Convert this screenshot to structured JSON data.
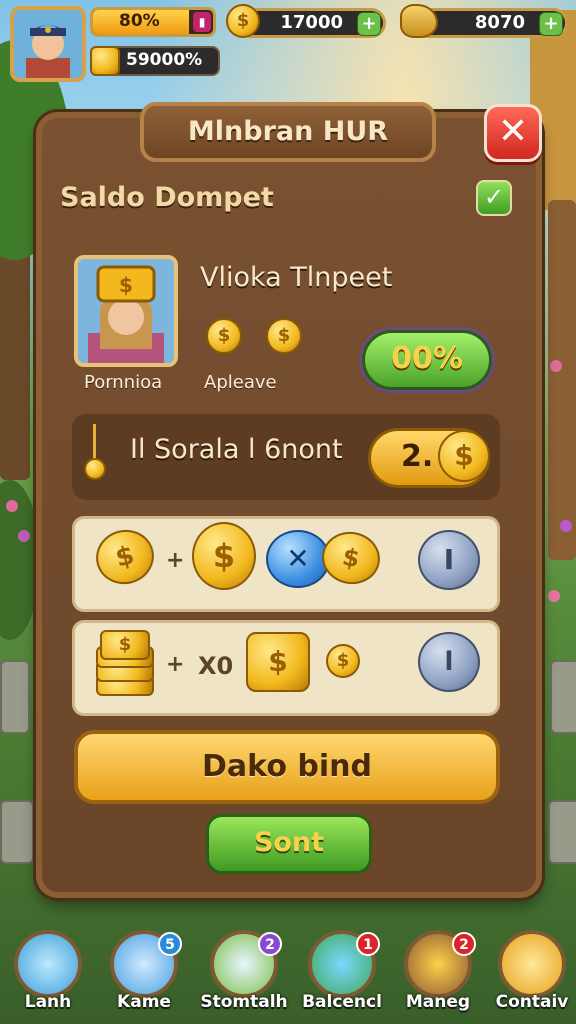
{
  "hud": {
    "energy_percent": "80%",
    "energy_fill": 0.8,
    "gems_line": "59000%",
    "gold_value": "17000",
    "resource_value": "8070"
  },
  "dialog": {
    "title": "Mlnbran HUR",
    "section_title": "Saldo Dompet",
    "profile": {
      "name": "Vlioka Tlnpeet",
      "portrait_label": "Pornnioa",
      "coins_label": "Apleave",
      "percent_button": "00%"
    },
    "balance": {
      "label": "Il Sorala l 6nont",
      "value": "2."
    },
    "row2": {
      "multiplier": "X0"
    },
    "primary_button": "Dako bind",
    "send_button": "Sont"
  },
  "nav": {
    "items": [
      {
        "label": "Lanh",
        "icon": "crystal-icon",
        "badge": "",
        "color": "#3fa0d8"
      },
      {
        "label": "Kame",
        "icon": "gem-icon",
        "badge": "5",
        "color": "#4aa0e0"
      },
      {
        "label": "Stomtalh",
        "icon": "clipboard-icon",
        "badge": "2",
        "color": "#7cc04a"
      },
      {
        "label": "Balcencl",
        "icon": "gear-icon",
        "badge": "1",
        "color": "#3fa85a"
      },
      {
        "label": "Maneg",
        "icon": "fox-icon",
        "badge": "2",
        "color": "#8a5a32"
      },
      {
        "label": "Contaiv",
        "icon": "scroll-icon",
        "badge": "",
        "color": "#e8a11a"
      }
    ]
  },
  "colors": {
    "panel": "#6a4528",
    "accent_gold": "#f2b81e",
    "accent_green": "#4aa329",
    "close_red": "#d1271e"
  }
}
